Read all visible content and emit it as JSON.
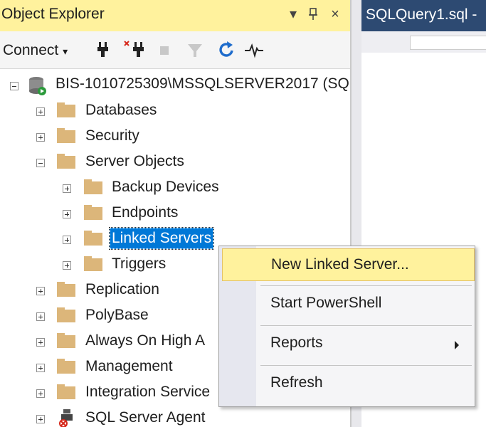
{
  "object_explorer": {
    "title": "Object Explorer",
    "title_buttons": {
      "dropdown": "▾",
      "pin": "ᵖ",
      "close": "×"
    },
    "toolbar": {
      "connect_label": "Connect",
      "connect_arrow": "▾"
    }
  },
  "tree": {
    "server": "BIS-1010725309\\MSSQLSERVER2017 (SQ",
    "nodes": [
      {
        "label": "Databases"
      },
      {
        "label": "Security"
      },
      {
        "label": "Server Objects"
      },
      {
        "label": "Backup Devices"
      },
      {
        "label": "Endpoints"
      },
      {
        "label": "Linked Servers"
      },
      {
        "label": "Triggers"
      },
      {
        "label": "Replication"
      },
      {
        "label": "PolyBase"
      },
      {
        "label": "Always On High A"
      },
      {
        "label": "Management"
      },
      {
        "label": "Integration Service"
      },
      {
        "label": "SQL Server Agent"
      }
    ]
  },
  "document_tab": {
    "title": "SQLQuery1.sql -"
  },
  "context_menu": {
    "items": [
      {
        "label": "New Linked Server..."
      },
      {
        "label": "Start PowerShell"
      },
      {
        "label": "Reports"
      },
      {
        "label": "Refresh"
      }
    ]
  },
  "colors": {
    "title_bar": "#fff29d",
    "selection": "#0078d7",
    "doc_tab": "#2d4a72",
    "folder": "#dcb67a"
  }
}
